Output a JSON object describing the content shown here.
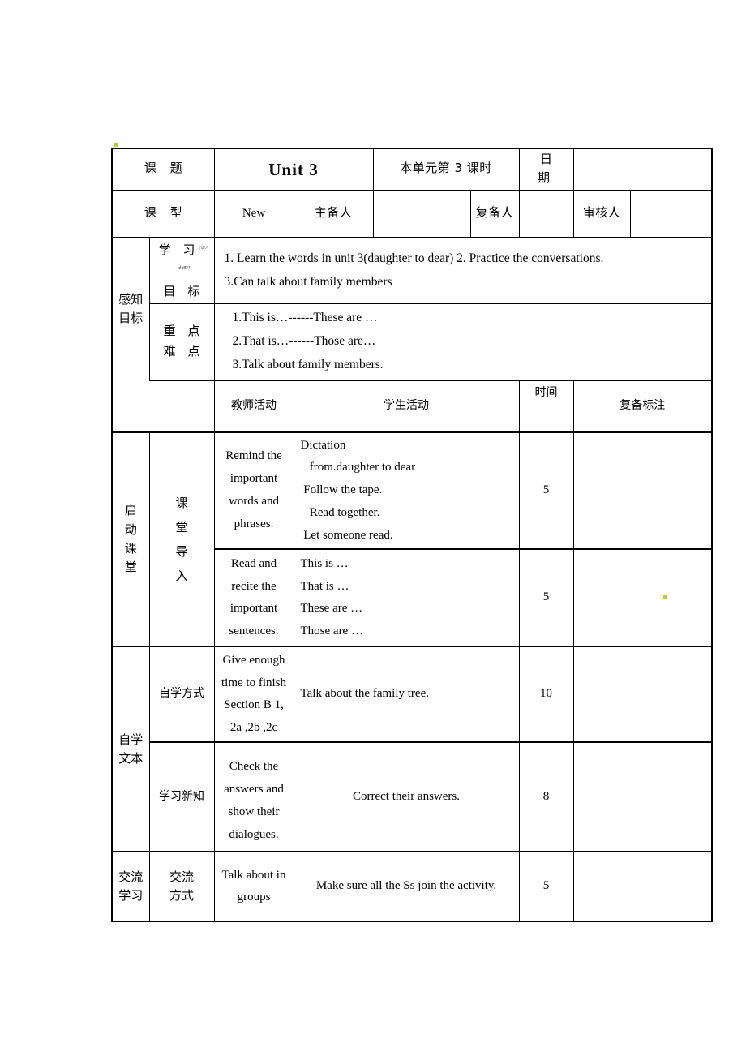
{
  "document": {
    "header": {
      "subject_label": "课 题",
      "subject_value": "Unit  3",
      "period_label": "本单元第 3 课时",
      "date_label": "日 期",
      "date_value": "",
      "type_label": "课 型",
      "type_value": "New",
      "main_preparer_label": "主备人",
      "main_preparer_value": "",
      "re_preparer_label": "复备人",
      "re_preparer_value": "",
      "reviewer_label": "审核人",
      "reviewer_value": ""
    },
    "goals": {
      "section_label_l1": "感知",
      "section_label_l2": "目标",
      "learning_goal_label_l1": "学 习",
      "learning_goal_label_note": "(填入本课时",
      "learning_goal_label_l2": "目 标",
      "learning_goal_line1": "1. Learn the words in unit 3(daughter to dear) 2. Practice the conversations.",
      "learning_goal_line2": "3.Can talk about family members",
      "key_points_label_l1": "重 点",
      "key_points_label_l2": "难 点",
      "key_points_line1": "1.This is…------These are …",
      "key_points_line2": "2.That is…------Those are…",
      "key_points_line3": "3.Talk about family members."
    },
    "table_header": {
      "col_blank_1": "",
      "col_blank_2": "",
      "teacher_activity": "教师活动",
      "student_activity": "学生活动",
      "time": "时间",
      "notes": "复备标注"
    },
    "rows": [
      {
        "stage_chars": [
          "启",
          "动",
          "课",
          "堂"
        ],
        "stage_rowspan": 2,
        "method_chars": [
          "课",
          "堂",
          "导",
          "入"
        ],
        "method_rowspan": 2,
        "teacher": [
          "Remind the",
          "important",
          "words and",
          "phrases."
        ],
        "student": [
          "Dictation",
          "   from.daughter to dear",
          " Follow the tape.",
          "   Read together.",
          " Let someone read."
        ],
        "student_align": "left",
        "time": "5",
        "notes": ""
      },
      {
        "teacher": [
          "Read and",
          "recite the",
          "important",
          "sentences."
        ],
        "student": [
          "This is …",
          "That is …",
          "These are …",
          "Those are …"
        ],
        "student_align": "left",
        "time": "5",
        "notes": ""
      },
      {
        "stage_chars": [
          "自学",
          "文本"
        ],
        "stage_rowspan": 2,
        "method_label": "自学方式",
        "teacher": [
          "Give enough",
          "time to finish",
          "Section B 1,",
          "2a ,2b ,2c"
        ],
        "student": [
          "Talk about the family tree."
        ],
        "student_align": "left",
        "time": "10",
        "notes": ""
      },
      {
        "method_label": "学习新知",
        "teacher": [
          "Check the",
          "answers and",
          "show their",
          "dialogues."
        ],
        "student": [
          "Correct their answers."
        ],
        "student_align": "center",
        "time": "8",
        "notes": ""
      },
      {
        "stage_chars": [
          "交流",
          "学习"
        ],
        "stage_rowspan": 1,
        "method_chars": [
          "交流",
          "方式"
        ],
        "teacher": [
          "Talk about in",
          "groups"
        ],
        "student": [
          "Make sure all the Ss join the activity."
        ],
        "student_align": "center",
        "time": "5",
        "notes": ""
      }
    ]
  }
}
